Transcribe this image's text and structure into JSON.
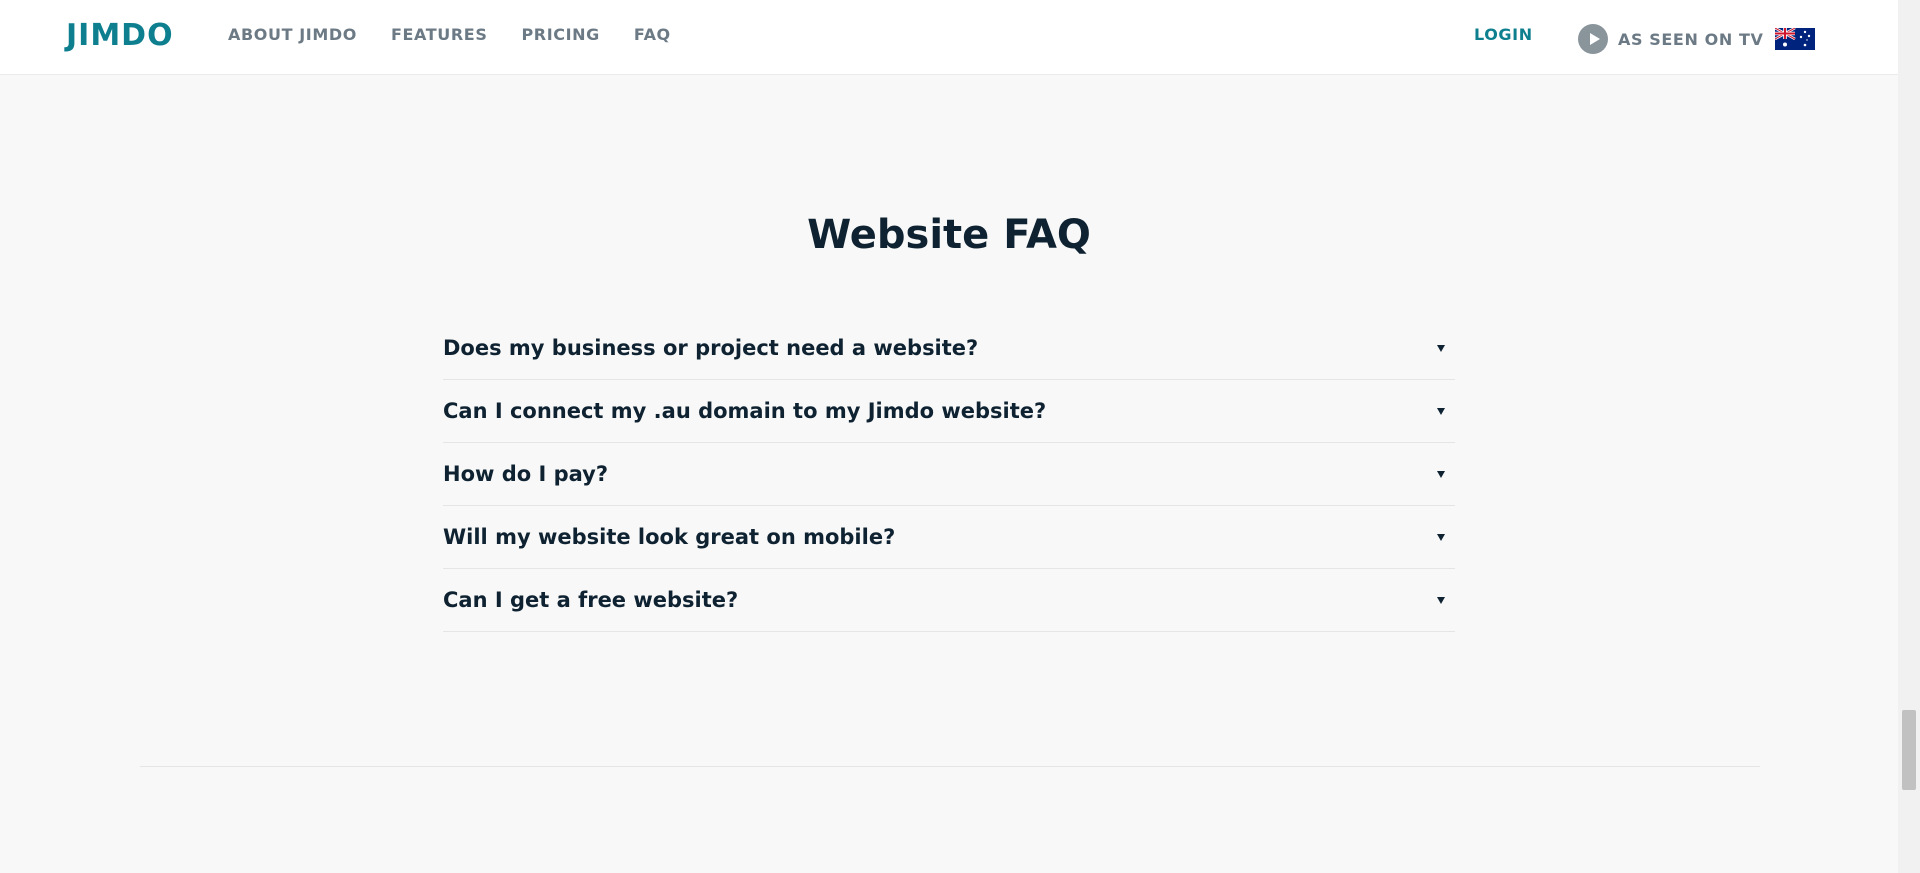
{
  "header": {
    "logo": "JIMDO",
    "nav": [
      "ABOUT JIMDO",
      "FEATURES",
      "PRICING",
      "FAQ"
    ],
    "login": "LOGIN",
    "tv_label": "AS SEEN ON TV",
    "flag": "australia-flag-icon",
    "colors": {
      "brand": "#0e7f8f",
      "nav": "#6c7a85"
    }
  },
  "faq": {
    "title": "Website FAQ",
    "questions": [
      "Does my business or project need a website?",
      "Can I connect my .au domain to my Jimdo website?",
      "How do I pay?",
      "Will my website look great on mobile?",
      "Can I get a free website?"
    ]
  }
}
